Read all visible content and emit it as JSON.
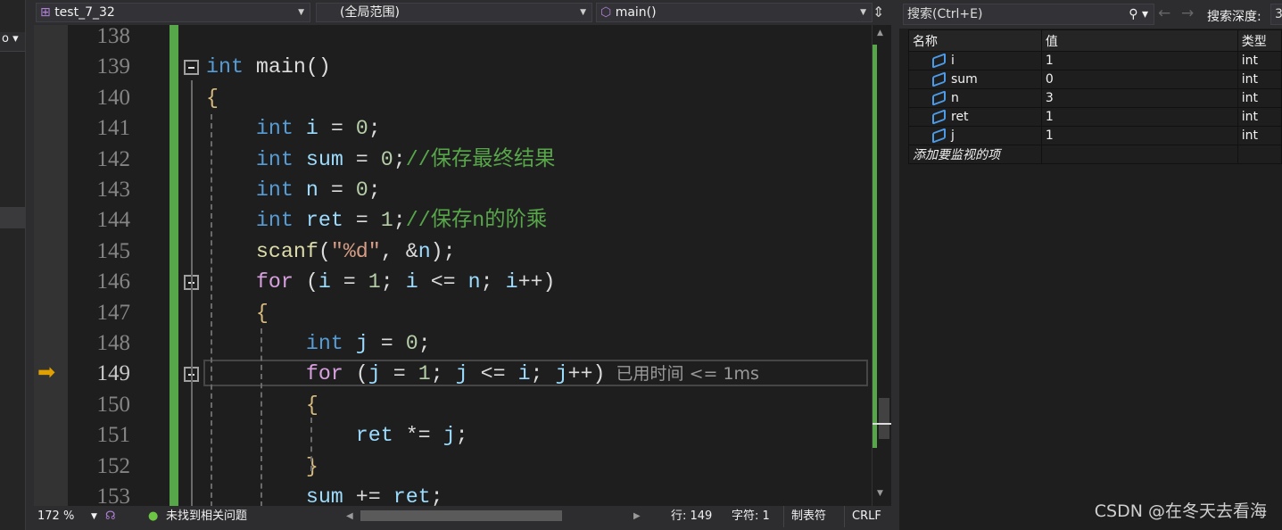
{
  "toolbar": {
    "project": "test_7_32",
    "scope": "(全局范围)",
    "function": "main()",
    "left_tool": "o ▾"
  },
  "editor": {
    "current_line": 149,
    "lines": [
      {
        "num": "138",
        "tokens": []
      },
      {
        "num": "139",
        "tokens": [
          [
            "int",
            "k"
          ],
          [
            " main()",
            "p"
          ]
        ]
      },
      {
        "num": "140",
        "tokens": [
          [
            "{",
            "b"
          ]
        ]
      },
      {
        "num": "141",
        "tokens": [
          [
            "    ",
            "p"
          ],
          [
            "int",
            "k"
          ],
          [
            " ",
            "p"
          ],
          [
            "i",
            "v"
          ],
          [
            " = ",
            "p"
          ],
          [
            "0",
            "n"
          ],
          [
            ";",
            "p"
          ]
        ]
      },
      {
        "num": "142",
        "tokens": [
          [
            "    ",
            "p"
          ],
          [
            "int",
            "k"
          ],
          [
            " ",
            "p"
          ],
          [
            "sum",
            "v"
          ],
          [
            " = ",
            "p"
          ],
          [
            "0",
            "n"
          ],
          [
            ";",
            "p"
          ],
          [
            "//保存最终结果",
            "cm"
          ]
        ]
      },
      {
        "num": "143",
        "tokens": [
          [
            "    ",
            "p"
          ],
          [
            "int",
            "k"
          ],
          [
            " ",
            "p"
          ],
          [
            "n",
            "v"
          ],
          [
            " = ",
            "p"
          ],
          [
            "0",
            "n"
          ],
          [
            ";",
            "p"
          ]
        ]
      },
      {
        "num": "144",
        "tokens": [
          [
            "    ",
            "p"
          ],
          [
            "int",
            "k"
          ],
          [
            " ",
            "p"
          ],
          [
            "ret",
            "v"
          ],
          [
            " = ",
            "p"
          ],
          [
            "1",
            "n"
          ],
          [
            ";",
            "p"
          ],
          [
            "//保存n的阶乘",
            "cm"
          ]
        ]
      },
      {
        "num": "145",
        "tokens": [
          [
            "    ",
            "p"
          ],
          [
            "scanf",
            "f"
          ],
          [
            "(",
            "p"
          ],
          [
            "\"%d\"",
            "s"
          ],
          [
            ", &",
            "p"
          ],
          [
            "n",
            "v"
          ],
          [
            ");",
            "p"
          ]
        ]
      },
      {
        "num": "146",
        "tokens": [
          [
            "    ",
            "p"
          ],
          [
            "for",
            "c"
          ],
          [
            " (",
            "p"
          ],
          [
            "i",
            "v"
          ],
          [
            " = ",
            "p"
          ],
          [
            "1",
            "n"
          ],
          [
            "; ",
            "p"
          ],
          [
            "i",
            "v"
          ],
          [
            " <= ",
            "p"
          ],
          [
            "n",
            "v"
          ],
          [
            "; ",
            "p"
          ],
          [
            "i",
            "v"
          ],
          [
            "++)",
            "p"
          ]
        ]
      },
      {
        "num": "147",
        "tokens": [
          [
            "    ",
            "p"
          ],
          [
            "{",
            "b"
          ]
        ]
      },
      {
        "num": "148",
        "tokens": [
          [
            "        ",
            "p"
          ],
          [
            "int",
            "k"
          ],
          [
            " ",
            "p"
          ],
          [
            "j",
            "v"
          ],
          [
            " = ",
            "p"
          ],
          [
            "0",
            "n"
          ],
          [
            ";",
            "p"
          ]
        ]
      },
      {
        "num": "149",
        "tokens": [
          [
            "        ",
            "p"
          ],
          [
            "for",
            "c"
          ],
          [
            " (",
            "p"
          ],
          [
            "j",
            "v"
          ],
          [
            " = ",
            "p"
          ],
          [
            "1",
            "n"
          ],
          [
            "; ",
            "p"
          ],
          [
            "j",
            "v"
          ],
          [
            " <= ",
            "p"
          ],
          [
            "i",
            "v"
          ],
          [
            "; ",
            "p"
          ],
          [
            "j",
            "v"
          ],
          [
            "++)",
            "p"
          ],
          [
            "  已用时间 <= 1ms",
            "t"
          ]
        ]
      },
      {
        "num": "150",
        "tokens": [
          [
            "        ",
            "p"
          ],
          [
            "{",
            "b"
          ]
        ]
      },
      {
        "num": "151",
        "tokens": [
          [
            "            ",
            "p"
          ],
          [
            "ret",
            "v"
          ],
          [
            " *= ",
            "p"
          ],
          [
            "j",
            "v"
          ],
          [
            ";",
            "p"
          ]
        ]
      },
      {
        "num": "152",
        "tokens": [
          [
            "        ",
            "p"
          ],
          [
            "}",
            "b"
          ]
        ]
      },
      {
        "num": "153",
        "tokens": [
          [
            "        ",
            "p"
          ],
          [
            "sum",
            "v"
          ],
          [
            " += ",
            "p"
          ],
          [
            "ret",
            "v"
          ],
          [
            ";",
            "p"
          ]
        ]
      }
    ]
  },
  "status": {
    "zoom": "172 %",
    "issues": "未找到相关问题",
    "line": "行: 149",
    "char": "字符: 1",
    "tabs": "制表符",
    "eol": "CRLF"
  },
  "watch": {
    "search_placeholder": "搜索(Ctrl+E)",
    "depth_label": "搜索深度:",
    "depth_value": "3",
    "columns": [
      "名称",
      "值",
      "类型"
    ],
    "rows": [
      {
        "name": "i",
        "value": "1",
        "type": "int"
      },
      {
        "name": "sum",
        "value": "0",
        "type": "int"
      },
      {
        "name": "n",
        "value": "3",
        "type": "int"
      },
      {
        "name": "ret",
        "value": "1",
        "type": "int"
      },
      {
        "name": "j",
        "value": "1",
        "type": "int"
      }
    ],
    "add_item": "添加要监视的项"
  },
  "watermark": "CSDN @在冬天去看海"
}
